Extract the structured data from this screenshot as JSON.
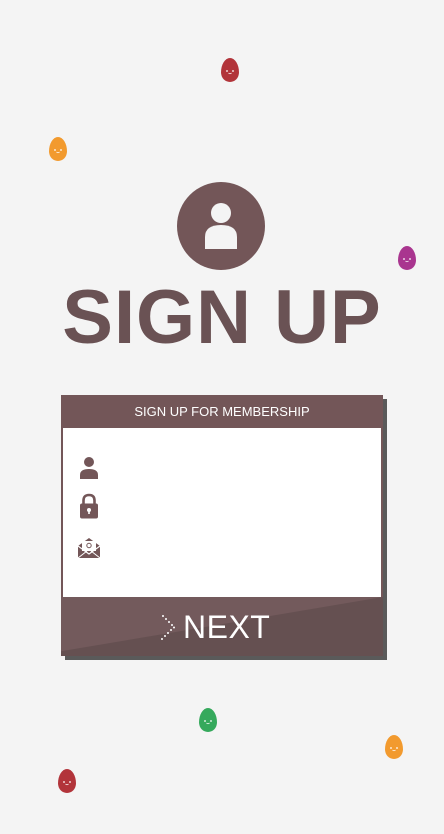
{
  "colors": {
    "background": "#f4f4f4",
    "primary": "#735658",
    "title": "#6a5254",
    "egg_red": "#b2343a",
    "egg_orange": "#f29a2e",
    "egg_purple": "#a9358f",
    "egg_green": "#35a95c"
  },
  "page": {
    "title": "SIGN UP"
  },
  "form": {
    "header": "SIGN UP FOR MEMBERSHIP",
    "fields": [
      {
        "icon": "user-icon",
        "value": "",
        "placeholder": ""
      },
      {
        "icon": "lock-icon",
        "value": "",
        "placeholder": ""
      },
      {
        "icon": "envelope-icon",
        "value": "",
        "placeholder": ""
      }
    ],
    "next_label": "NEXT"
  },
  "decorations": [
    {
      "icon": "egg-icon",
      "color": "red"
    },
    {
      "icon": "egg-icon",
      "color": "orange"
    },
    {
      "icon": "egg-icon",
      "color": "purple"
    },
    {
      "icon": "egg-icon",
      "color": "green"
    },
    {
      "icon": "egg-icon",
      "color": "orange"
    },
    {
      "icon": "egg-icon",
      "color": "red"
    }
  ]
}
